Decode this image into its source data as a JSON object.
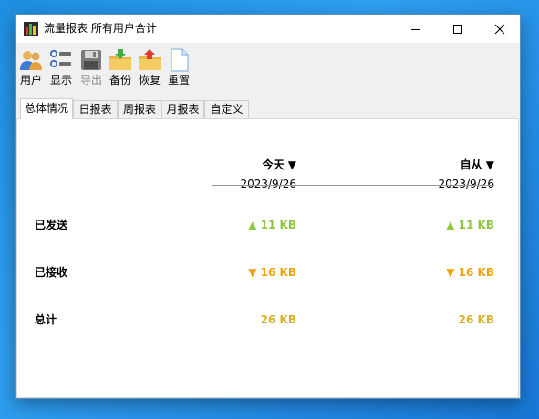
{
  "window": {
    "title": "流量报表 所有用户合计"
  },
  "toolbar": {
    "items": [
      {
        "label": "用户",
        "icon": "users-icon",
        "enabled": true
      },
      {
        "label": "显示",
        "icon": "display-list-icon",
        "enabled": true
      },
      {
        "label": "导出",
        "icon": "floppy-disk-icon",
        "enabled": false
      },
      {
        "label": "备份",
        "icon": "folder-download-icon",
        "enabled": true
      },
      {
        "label": "恢复",
        "icon": "folder-upload-icon",
        "enabled": true
      },
      {
        "label": "重置",
        "icon": "blank-document-icon",
        "enabled": true
      }
    ]
  },
  "tabs": [
    {
      "label": "总体情况",
      "active": true
    },
    {
      "label": "日报表",
      "active": false
    },
    {
      "label": "周报表",
      "active": false
    },
    {
      "label": "月报表",
      "active": false
    },
    {
      "label": "自定义",
      "active": false
    }
  ],
  "report": {
    "columns": [
      {
        "header": "今天 ▼",
        "date": "2023/9/26"
      },
      {
        "header": "自从 ▼",
        "date": "2023/9/26"
      }
    ],
    "rows": [
      {
        "label": "已发送",
        "values": [
          "▲ 11 KB",
          "▲ 11 KB"
        ],
        "color": "#8dc63f"
      },
      {
        "label": "已接收",
        "values": [
          "▼ 16 KB",
          "▼ 16 KB"
        ],
        "color": "#f0a20e"
      },
      {
        "label": "总计",
        "values": [
          "26 KB",
          "26 KB"
        ],
        "color": "#d9b12a"
      }
    ]
  },
  "colors": {
    "desktop": "#2f9ff0",
    "sent": "#8dc63f",
    "received": "#f0a20e",
    "total": "#d9b12a"
  }
}
